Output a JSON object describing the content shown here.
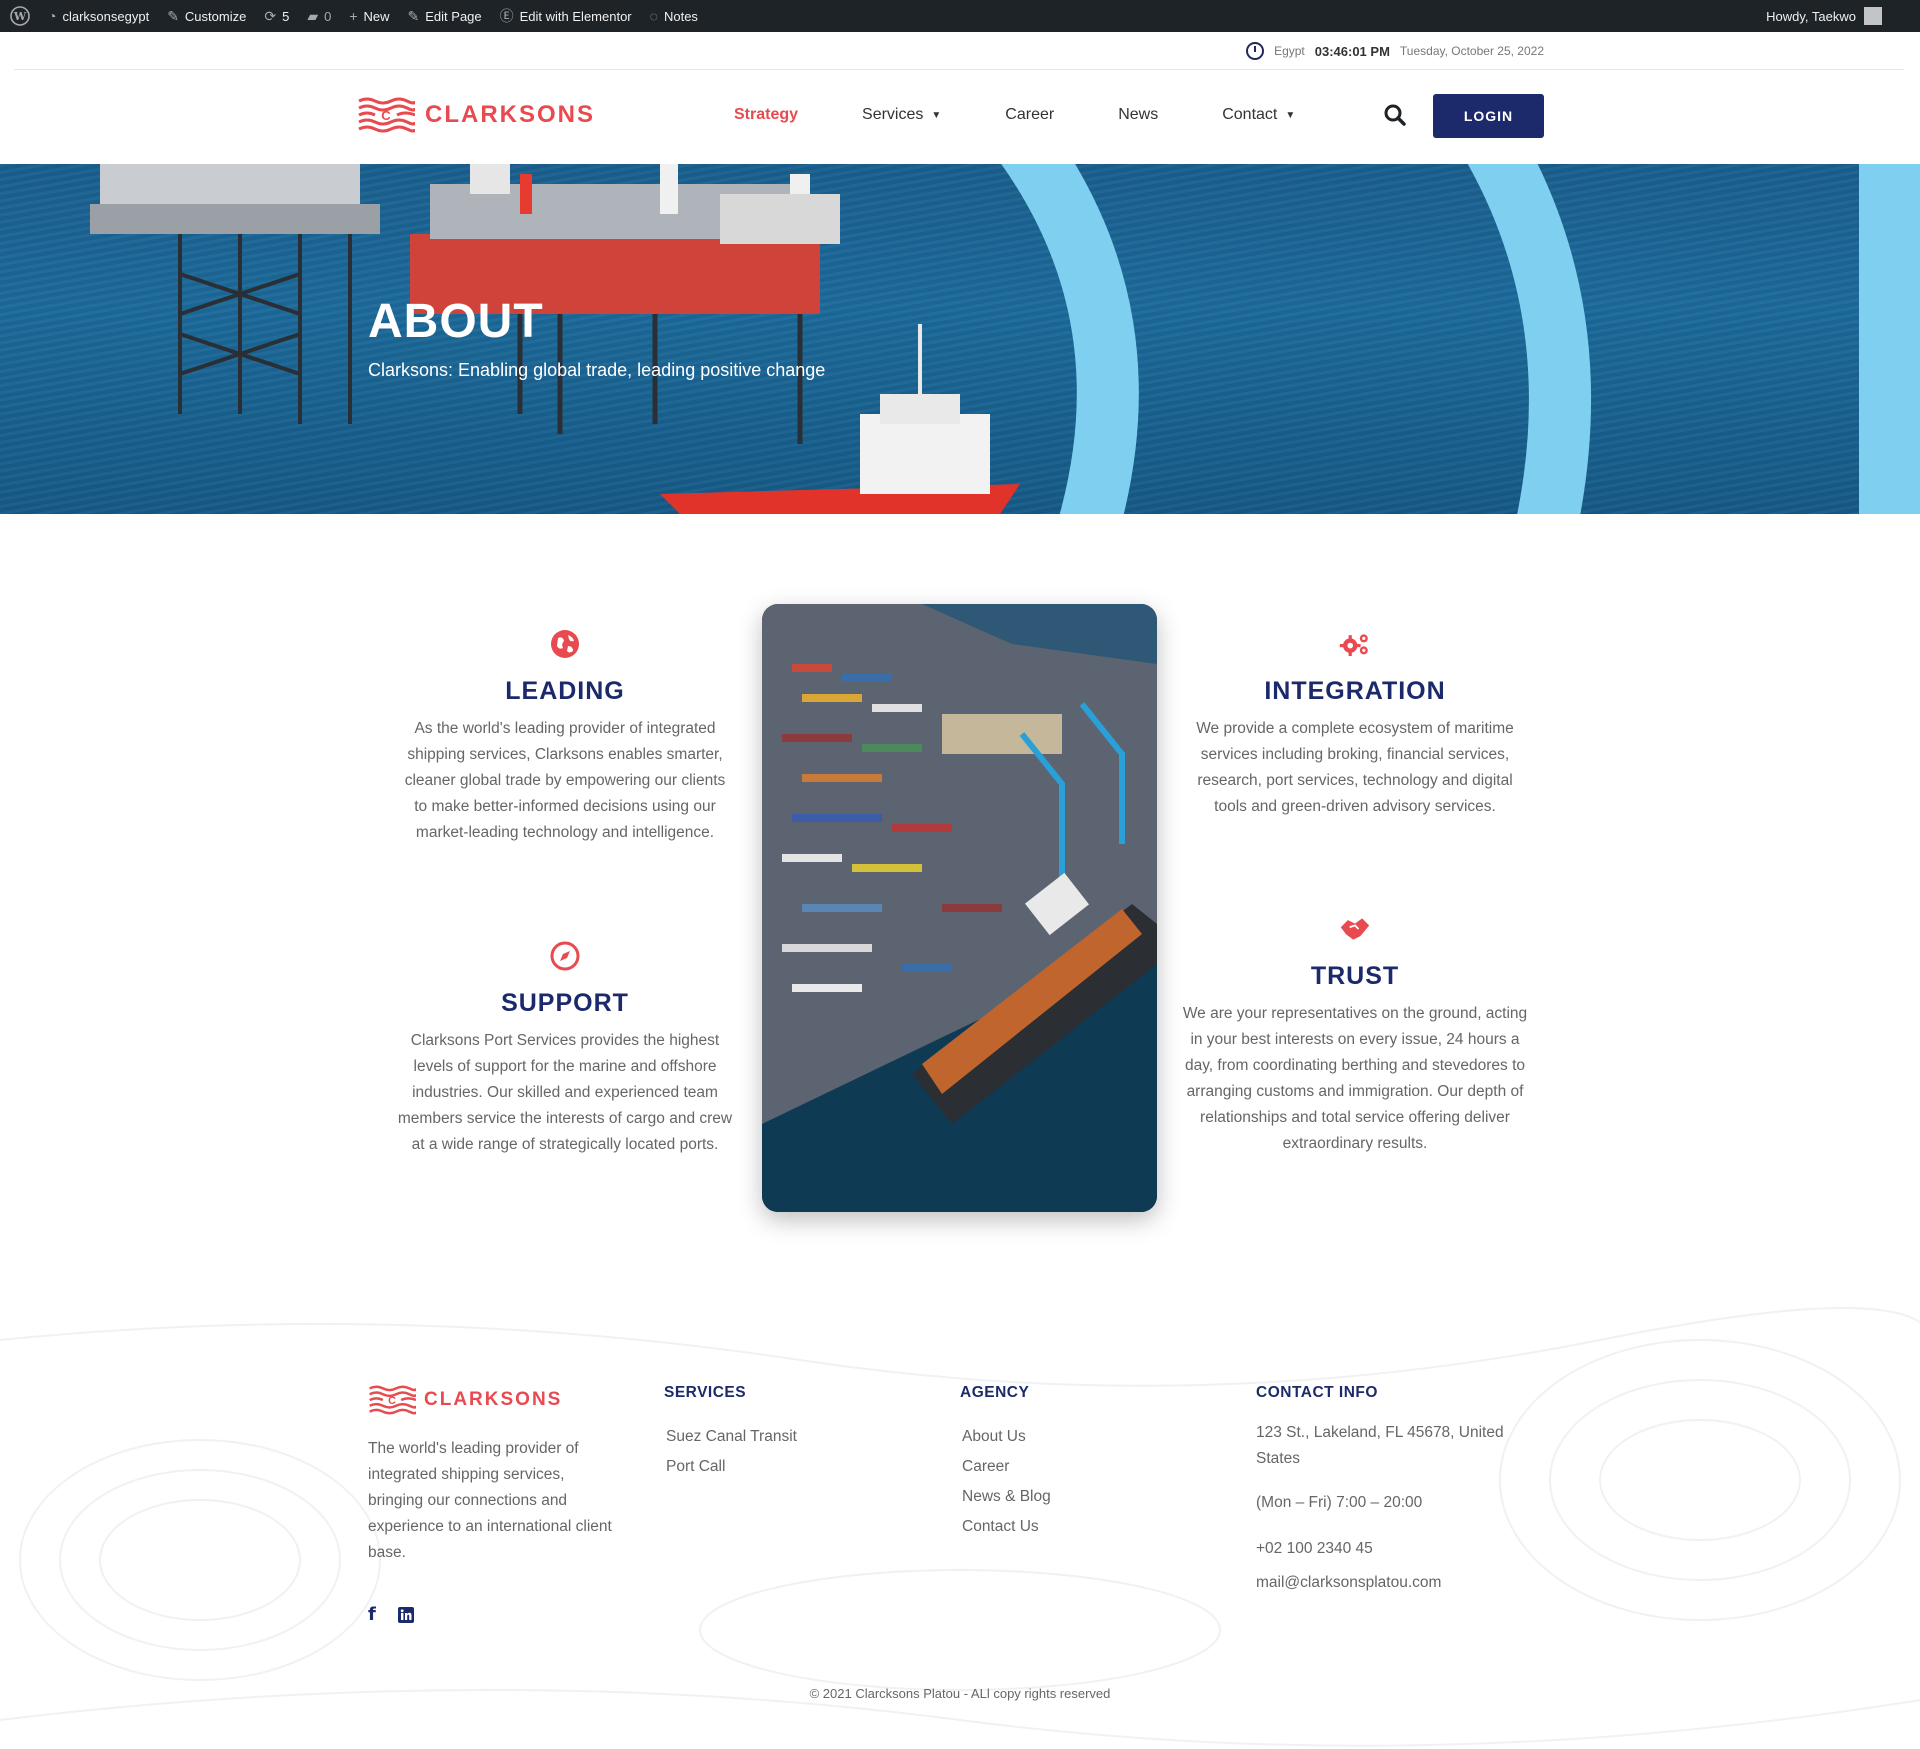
{
  "adminbar": {
    "site": "clarksonsegypt",
    "customize": "Customize",
    "updates": "5",
    "comments": "0",
    "new": "New",
    "edit_page": "Edit Page",
    "elementor": "Edit with Elementor",
    "notes": "Notes",
    "howdy": "Howdy, Taekwo"
  },
  "topinfo": {
    "location": "Egypt",
    "time": "03:46:01 PM",
    "date": "Tuesday, October 25, 2022"
  },
  "header": {
    "logo_text": "CLARKSONS",
    "nav": [
      "Strategy",
      "Services",
      "Career",
      "News",
      "Contact"
    ],
    "login": "LOGIN"
  },
  "hero": {
    "title": "ABOUT",
    "subtitle": "Clarksons: Enabling global trade, leading positive change"
  },
  "features": {
    "leading": {
      "title": "LEADING",
      "text": "As the world's leading provider of integrated shipping services, Clarksons enables smarter, cleaner global trade by empowering our clients to make better-informed decisions using our market-leading technology and intelligence."
    },
    "support": {
      "title": "SUPPORT",
      "text": "Clarksons Port Services provides the highest levels of support for the marine and offshore industries. Our skilled and experienced team members service the interests of cargo and crew at a wide range of strategically located ports."
    },
    "integration": {
      "title": "INTEGRATION",
      "text": "We provide a complete ecosystem of maritime services including broking, financial services, research, port services, technology and digital tools and green-driven advisory services."
    },
    "trust": {
      "title": "TRUST",
      "text": "We are your representatives on the ground, acting in your best interests on every issue, 24 hours a day, from coordinating berthing and stevedores to arranging customs and immigration. Our depth of relationships and total service offering deliver extraordinary results."
    }
  },
  "footer": {
    "logo_text": "CLARKSONS",
    "description": "The world's leading provider of integrated shipping services, bringing our connections and experience to an international client base.",
    "services_title": "SERVICES",
    "services": [
      "Suez Canal Transit",
      "Port Call"
    ],
    "agency_title": "AGENCY",
    "agency": [
      "About Us",
      "Career",
      "News & Blog",
      "Contact Us"
    ],
    "contact_title": "CONTACT INFO",
    "address": "123 St., Lakeland, FL 45678, United States",
    "hours": "(Mon – Fri) 7:00 – 20:00",
    "phone": "+02 100 2340 45",
    "email": "mail@clarksonsplatou.com",
    "copyright": "© 2021 Clarcksons Platou - ALl copy rights reserved"
  },
  "colors": {
    "brand_red": "#e84a4f",
    "brand_navy": "#1c2a6b",
    "admin_bar": "#1d2327"
  }
}
